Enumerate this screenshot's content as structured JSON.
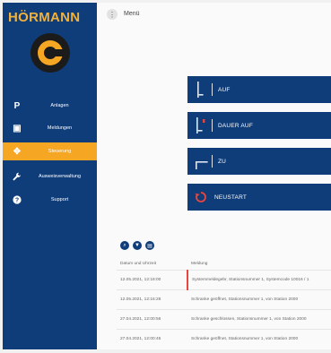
{
  "app": {
    "brand": "HÖRMANN",
    "menu_label": "Menü"
  },
  "colors": {
    "primary": "#0f3d7a",
    "accent": "#f5a623",
    "danger": "#e8463e"
  },
  "sidebar": {
    "items": [
      {
        "icon": "parking-icon",
        "glyph": "P",
        "label": "Anlagen",
        "active": false
      },
      {
        "icon": "messages-icon",
        "glyph": "▣",
        "label": "Meldungen",
        "active": false
      },
      {
        "icon": "control-icon",
        "glyph": "✥",
        "label": "Steuerung",
        "active": true
      },
      {
        "icon": "wrench-icon",
        "glyph": "🔧",
        "label": "Ausweisverwaltung",
        "active": false
      },
      {
        "icon": "help-icon",
        "glyph": "?",
        "label": "Support",
        "active": false
      }
    ]
  },
  "controls": [
    {
      "icon": "barrier-up-icon",
      "label": "AUF"
    },
    {
      "icon": "barrier-permanent-open-icon",
      "label": "DAUER AUF"
    },
    {
      "icon": "barrier-down-icon",
      "label": "ZU"
    },
    {
      "icon": "restart-icon",
      "label": "NEUSTART"
    }
  ],
  "toolbar": [
    {
      "icon": "search-icon",
      "glyph": "⌕"
    },
    {
      "icon": "filter-icon",
      "glyph": "▼"
    },
    {
      "icon": "export-icon",
      "glyph": "▤"
    }
  ],
  "log": {
    "columns": [
      "Datum und Uhrzeit",
      "Meldung"
    ],
    "rows": [
      [
        "12.05.2021, 12:18:00",
        "Systemmeldegebr, Stationsnummer 1, Systemcode 10016 / 1"
      ],
      [
        "12.05.2021, 12:16:28",
        "Schranke geöffnet, Stationsnummer 1, von Station 2000"
      ],
      [
        "27.04.2021, 12:00:56",
        "Schranke geschlossen, Stationsnummer 1, von Station 2000"
      ],
      [
        "27.04.2021, 12:00:45",
        "Schranke geöffnet, Stationsnummer 1, von Station 2000"
      ]
    ]
  }
}
